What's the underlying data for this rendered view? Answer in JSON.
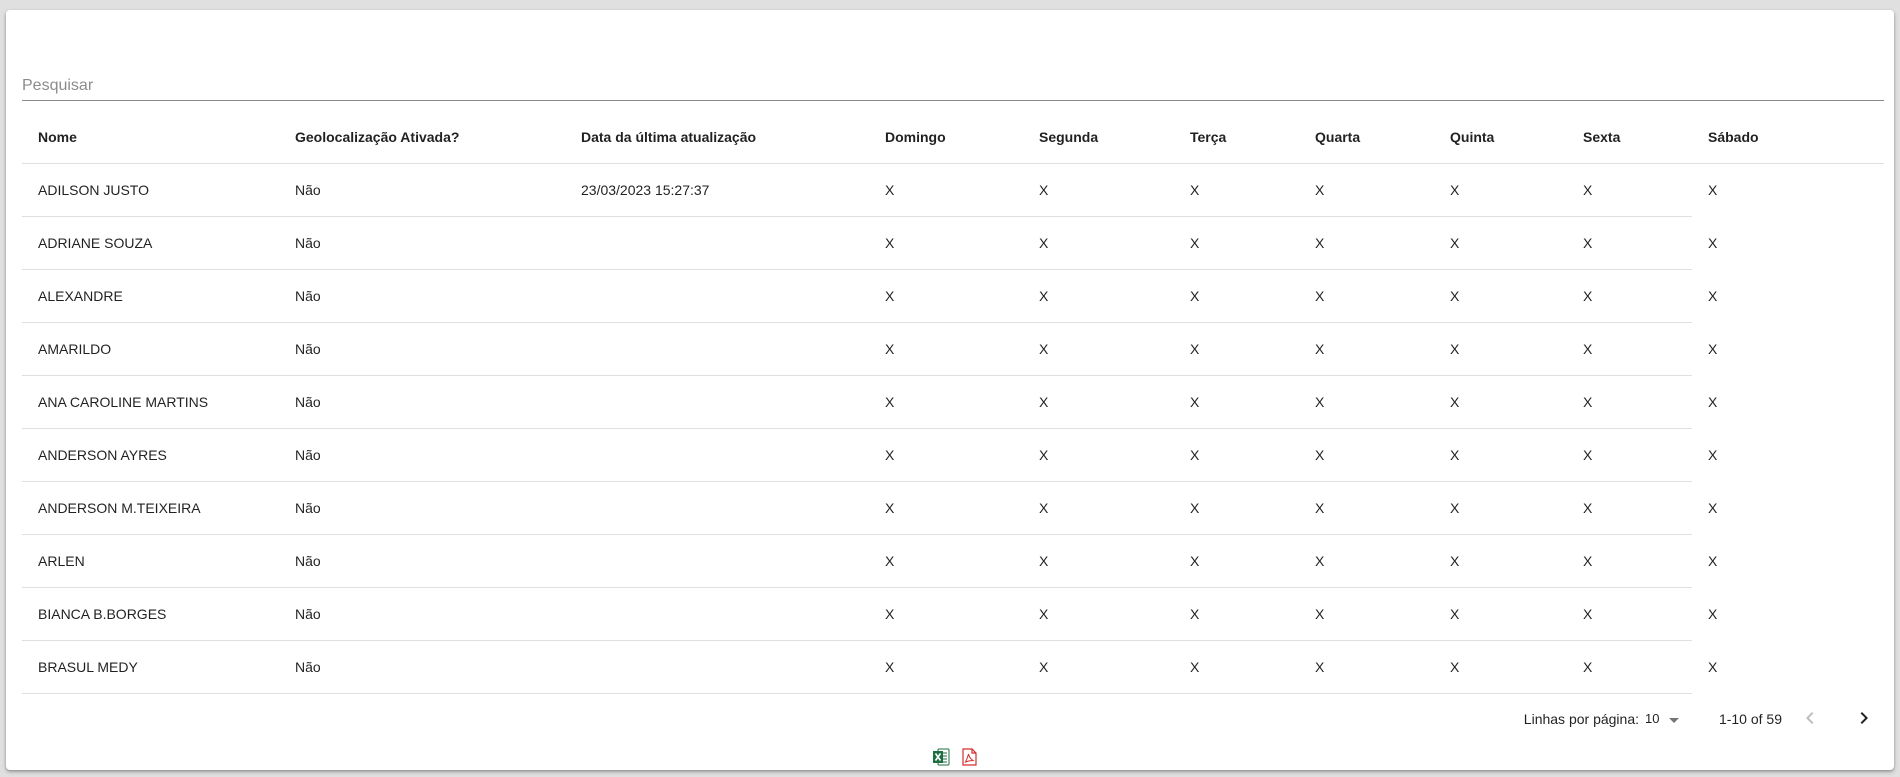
{
  "search": {
    "placeholder": "Pesquisar",
    "value": ""
  },
  "table": {
    "columns": [
      "Nome",
      "Geolocalização Ativada?",
      "Data da última atualização",
      "Domingo",
      "Segunda",
      "Terça",
      "Quarta",
      "Quinta",
      "Sexta",
      "Sábado"
    ],
    "rows": [
      [
        "ADILSON JUSTO",
        "Não",
        "23/03/2023 15:27:37",
        "X",
        "X",
        "X",
        "X",
        "X",
        "X",
        "X"
      ],
      [
        "ADRIANE SOUZA",
        "Não",
        "",
        "X",
        "X",
        "X",
        "X",
        "X",
        "X",
        "X"
      ],
      [
        "ALEXANDRE",
        "Não",
        "",
        "X",
        "X",
        "X",
        "X",
        "X",
        "X",
        "X"
      ],
      [
        "AMARILDO",
        "Não",
        "",
        "X",
        "X",
        "X",
        "X",
        "X",
        "X",
        "X"
      ],
      [
        "ANA CAROLINE MARTINS",
        "Não",
        "",
        "X",
        "X",
        "X",
        "X",
        "X",
        "X",
        "X"
      ],
      [
        "ANDERSON AYRES",
        "Não",
        "",
        "X",
        "X",
        "X",
        "X",
        "X",
        "X",
        "X"
      ],
      [
        "ANDERSON M.TEIXEIRA",
        "Não",
        "",
        "X",
        "X",
        "X",
        "X",
        "X",
        "X",
        "X"
      ],
      [
        "ARLEN",
        "Não",
        "",
        "X",
        "X",
        "X",
        "X",
        "X",
        "X",
        "X"
      ],
      [
        "BIANCA B.BORGES",
        "Não",
        "",
        "X",
        "X",
        "X",
        "X",
        "X",
        "X",
        "X"
      ],
      [
        "BRASUL MEDY",
        "Não",
        "",
        "X",
        "X",
        "X",
        "X",
        "X",
        "X",
        "X"
      ]
    ]
  },
  "pagination": {
    "rows_per_page_label": "Linhas por página:",
    "rows_per_page_value": "10",
    "range_text": "1-10 of 59"
  },
  "exports": {
    "excel_icon": "excel-icon",
    "pdf_icon": "pdf-icon",
    "excel_color": "#1d6f42",
    "pdf_color": "#d32f2f"
  }
}
